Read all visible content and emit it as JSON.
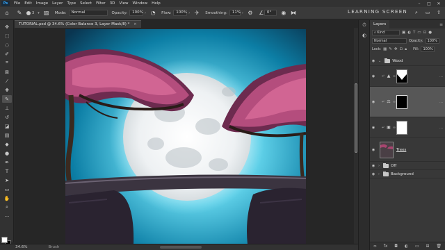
{
  "menubar": {
    "logo": "Ps",
    "items": [
      "File",
      "Edit",
      "Image",
      "Layer",
      "Type",
      "Select",
      "Filter",
      "3D",
      "View",
      "Window",
      "Help"
    ]
  },
  "window_controls": [
    "–",
    "□",
    "✕"
  ],
  "options": {
    "brush_size": "3",
    "mode_label": "Mode:",
    "mode_value": "Normal",
    "opacity_label": "Opacity:",
    "opacity_value": "100%",
    "flow_label": "Flow:",
    "flow_value": "100%",
    "smoothing_label": "Smoothing:",
    "smoothing_value": "11%",
    "angle_value": "0°"
  },
  "brand": "LEARNING SCREEN",
  "document": {
    "tab_title": "TUTORIAL.psd @ 34.6% (Color Balance 3, Layer Mask/8) *",
    "tab_close": "×"
  },
  "status": {
    "zoom": "34.6%",
    "tool": "Brush"
  },
  "layers_panel": {
    "title": "Layers",
    "filter_kind": "Kind",
    "blend_mode": "Normal",
    "opacity_label": "Opacity:",
    "opacity_value": "100%",
    "lock_label": "Lock:",
    "fill_label": "Fill:",
    "fill_value": "100%",
    "layers": [
      {
        "name": "Wood",
        "kind": "group"
      },
      {
        "name": "",
        "kind": "adjustment-levels"
      },
      {
        "name": "",
        "kind": "adjustment-color-balance",
        "selected": true
      },
      {
        "name": "",
        "kind": "adjustment-photo-filter"
      },
      {
        "name": "Trees",
        "kind": "pixel"
      },
      {
        "name": "Off",
        "kind": "group"
      },
      {
        "name": "Background",
        "kind": "group"
      }
    ]
  },
  "colors": {
    "accent": "#31a8ff",
    "panel": "#383838",
    "canvas_sky": "#0e8fb3"
  }
}
